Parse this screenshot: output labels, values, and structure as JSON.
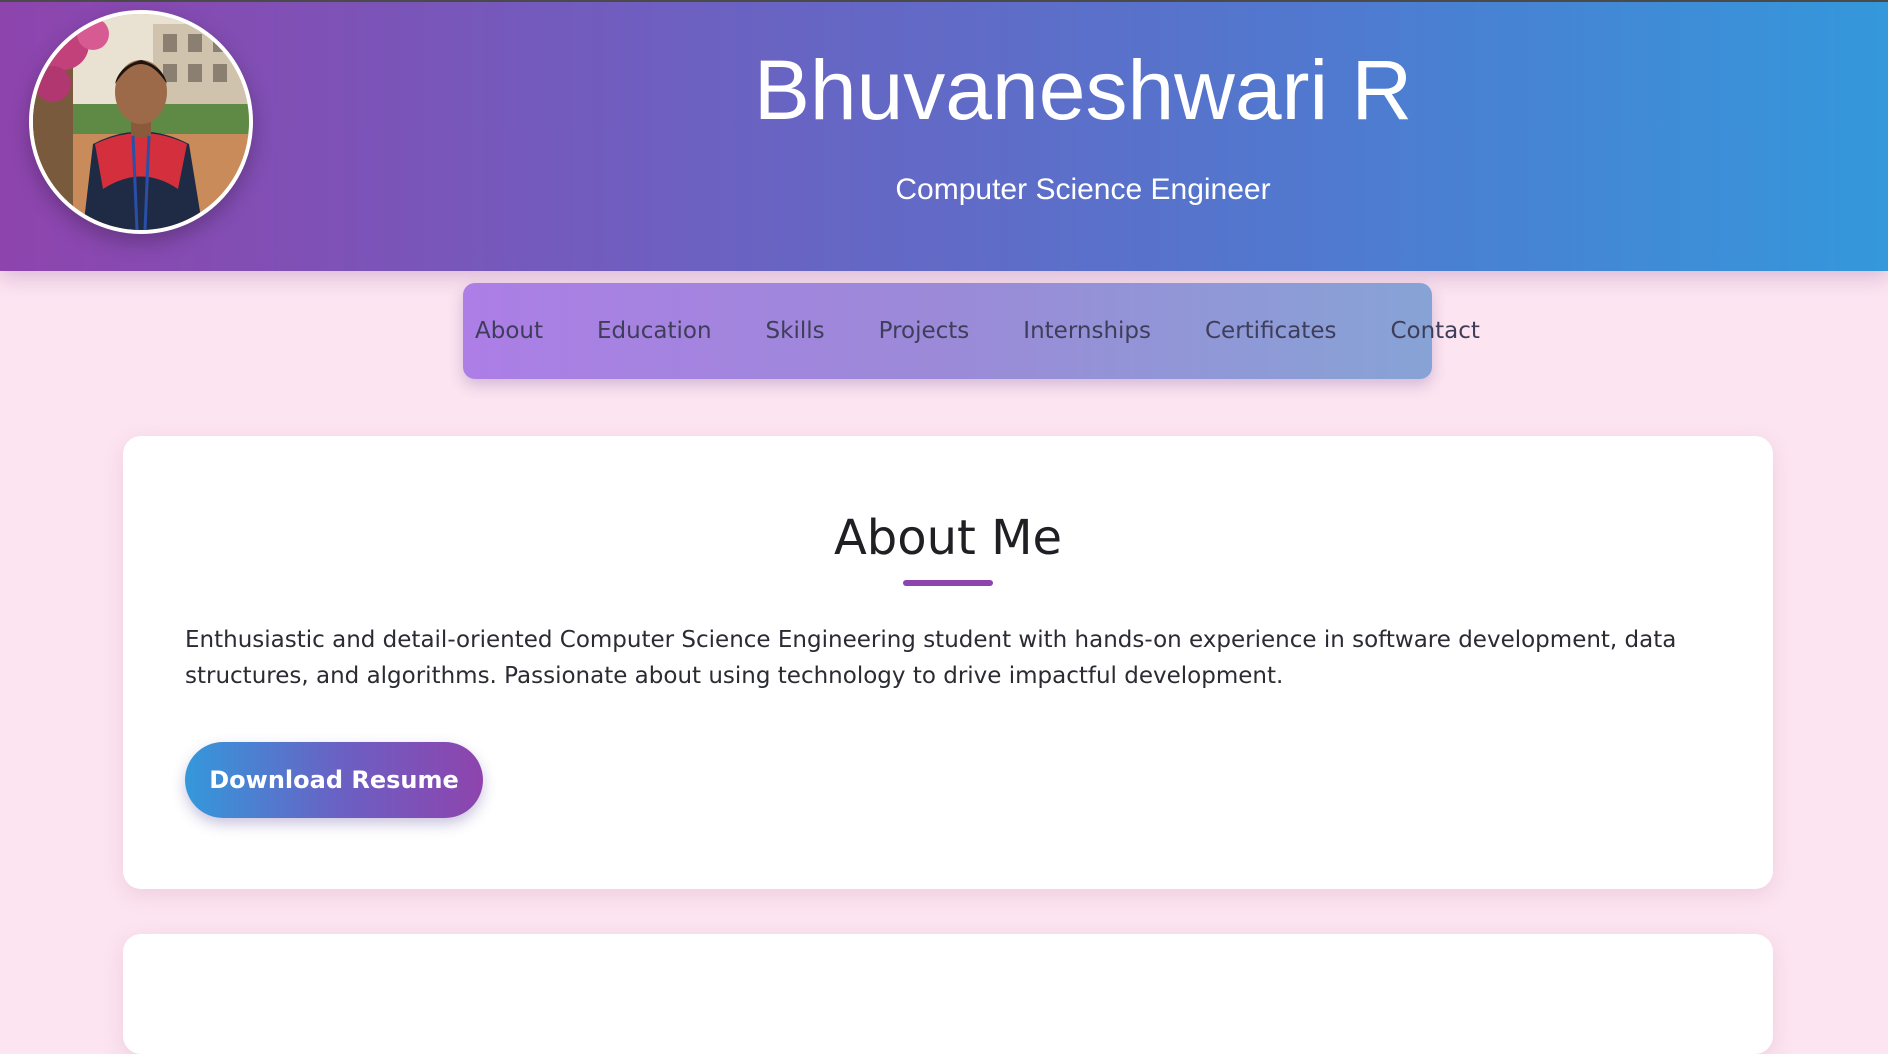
{
  "header": {
    "name": "Bhuvaneshwari R",
    "subtitle": "Computer Science Engineer"
  },
  "nav": {
    "items": [
      {
        "label": "About"
      },
      {
        "label": "Education"
      },
      {
        "label": "Skills"
      },
      {
        "label": "Projects"
      },
      {
        "label": "Internships"
      },
      {
        "label": "Certificates"
      },
      {
        "label": "Contact"
      }
    ]
  },
  "about": {
    "heading": "About Me",
    "text": "Enthusiastic and detail-oriented Computer Science Engineering student with hands-on experience in software development, data structures, and algorithms. Passionate about using technology to drive impactful development.",
    "button_label": "Download Resume"
  },
  "colors": {
    "header_start": "#8e44ad",
    "header_end": "#3498db",
    "page_background": "#fce4f0",
    "accent": "#8e44ad"
  }
}
